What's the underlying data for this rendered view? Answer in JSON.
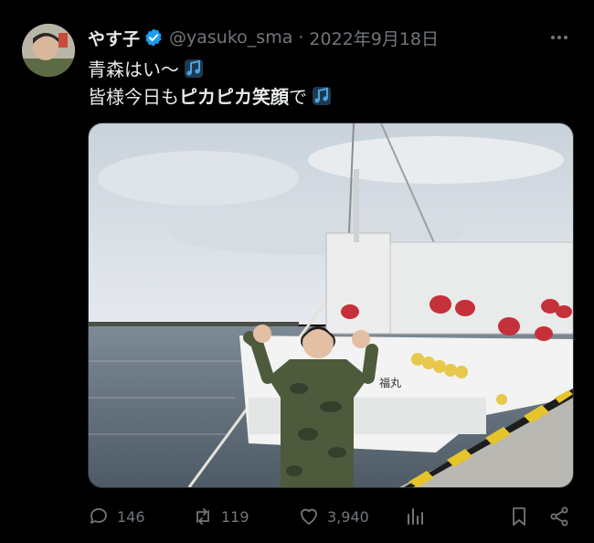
{
  "tweet": {
    "display_name": "やす子",
    "handle": "@yasuko_sma",
    "separator": "·",
    "date": "2022年9月18日",
    "line1": "青森はい〜",
    "line2_prefix": "皆様今日も",
    "line2_bold": "ピカピカ笑顔",
    "line2_suffix": "で"
  },
  "media": {
    "boat_name": "福丸"
  },
  "actions": {
    "replies": "146",
    "reposts": "119",
    "likes": "3,940"
  },
  "colors": {
    "verified": "#1d9bf0",
    "note": "#4fa3e0",
    "muted": "#71767b"
  },
  "icons": [
    "verified-badge-icon",
    "more-icon",
    "music-note-icon",
    "reply-icon",
    "repost-icon",
    "like-icon",
    "views-icon",
    "bookmark-icon",
    "share-icon"
  ]
}
